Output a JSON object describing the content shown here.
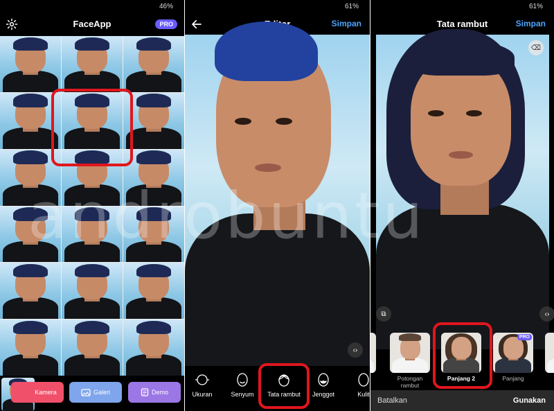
{
  "panel1": {
    "battery": "46%",
    "title": "FaceApp",
    "pro_badge": "PRO",
    "buttons": {
      "camera": "Kamera",
      "gallery": "Galeri",
      "demo": "Demo"
    },
    "colors": {
      "camera": "#f0506a",
      "gallery": "#7fa5ec",
      "demo": "#9b77e6"
    }
  },
  "panel2": {
    "battery": "61%",
    "title": "Editor",
    "save": "Simpan",
    "tools": [
      "Ukuran",
      "Senyum",
      "Tata rambut",
      "Jenggot",
      "Kulit"
    ]
  },
  "panel3": {
    "battery": "61%",
    "title": "Tata rambut",
    "save": "Simpan",
    "presets": [
      {
        "label": "Potongan rambut",
        "pro": ""
      },
      {
        "label": "Panjang 2",
        "pro": ""
      },
      {
        "label": "Panjang",
        "pro": "PRO"
      }
    ],
    "cancel": "Batalkan",
    "apply": "Gunakan"
  },
  "watermark": "androbuntu",
  "highlight_color": "#e0161d",
  "accent_color": "#4da3ff"
}
